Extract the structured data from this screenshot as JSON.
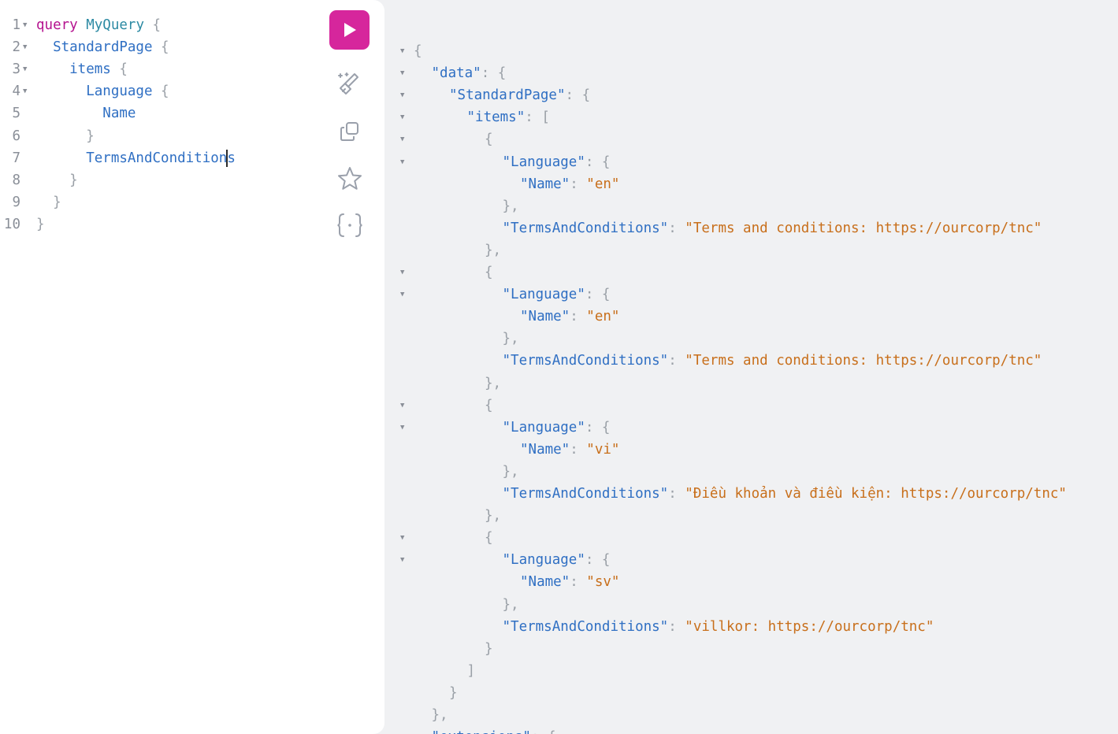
{
  "editor": {
    "lines": [
      {
        "num": "1",
        "tokens": [
          {
            "t": "query",
            "c": "kw"
          },
          {
            "t": " ",
            "c": ""
          },
          {
            "t": "MyQuery",
            "c": "op"
          },
          {
            "t": " {",
            "c": "pn"
          }
        ]
      },
      {
        "num": "2",
        "tokens": [
          {
            "t": "  StandardPage",
            "c": "fld"
          },
          {
            "t": " {",
            "c": "pn"
          }
        ]
      },
      {
        "num": "3",
        "tokens": [
          {
            "t": "    items",
            "c": "fld"
          },
          {
            "t": " {",
            "c": "pn"
          }
        ]
      },
      {
        "num": "4",
        "tokens": [
          {
            "t": "      Language",
            "c": "fld"
          },
          {
            "t": " {",
            "c": "pn"
          }
        ]
      },
      {
        "num": "5",
        "tokens": [
          {
            "t": "        Name",
            "c": "fld"
          }
        ]
      },
      {
        "num": "6",
        "tokens": [
          {
            "t": "      }",
            "c": "pn"
          }
        ]
      },
      {
        "num": "7",
        "tokens": [
          {
            "t": "      TermsAndCondition",
            "c": "fld"
          },
          {
            "t": "CURSOR",
            "c": ""
          },
          {
            "t": "s",
            "c": "fld"
          }
        ]
      },
      {
        "num": "8",
        "tokens": [
          {
            "t": "    }",
            "c": "pn"
          }
        ]
      },
      {
        "num": "9",
        "tokens": [
          {
            "t": "  }",
            "c": "pn"
          }
        ]
      },
      {
        "num": "10",
        "tokens": [
          {
            "t": "}",
            "c": "pn"
          }
        ]
      }
    ],
    "foldable_lines": [
      "1",
      "2",
      "3",
      "4"
    ]
  },
  "toolbar": {
    "run_button": {
      "label": "Execute query",
      "icon": "play-icon",
      "color": "#d6269c"
    },
    "tools": [
      {
        "name": "prettify-button",
        "icon": "prettify-icon"
      },
      {
        "name": "copy-button",
        "icon": "copy-icon"
      },
      {
        "name": "favorite-button",
        "icon": "star-icon"
      },
      {
        "name": "merge-fragments-button",
        "icon": "merge-icon"
      }
    ]
  },
  "result": {
    "lines": [
      {
        "indent": 0,
        "fold": true,
        "tokens": [
          {
            "t": "{",
            "c": "pn"
          }
        ]
      },
      {
        "indent": 1,
        "fold": true,
        "tokens": [
          {
            "t": "\"data\"",
            "c": "key"
          },
          {
            "t": ": {",
            "c": "pn"
          }
        ]
      },
      {
        "indent": 2,
        "fold": true,
        "tokens": [
          {
            "t": "\"StandardPage\"",
            "c": "key"
          },
          {
            "t": ": {",
            "c": "pn"
          }
        ]
      },
      {
        "indent": 3,
        "fold": true,
        "tokens": [
          {
            "t": "\"items\"",
            "c": "key"
          },
          {
            "t": ": [",
            "c": "pn"
          }
        ]
      },
      {
        "indent": 4,
        "fold": true,
        "tokens": [
          {
            "t": "{",
            "c": "pn"
          }
        ]
      },
      {
        "indent": 5,
        "fold": true,
        "tokens": [
          {
            "t": "\"Language\"",
            "c": "key"
          },
          {
            "t": ": {",
            "c": "pn"
          }
        ]
      },
      {
        "indent": 6,
        "fold": false,
        "tokens": [
          {
            "t": "\"Name\"",
            "c": "key"
          },
          {
            "t": ": ",
            "c": "pn"
          },
          {
            "t": "\"en\"",
            "c": "str"
          }
        ]
      },
      {
        "indent": 5,
        "fold": false,
        "tokens": [
          {
            "t": "},",
            "c": "pn"
          }
        ]
      },
      {
        "indent": 5,
        "fold": false,
        "tokens": [
          {
            "t": "\"TermsAndConditions\"",
            "c": "key"
          },
          {
            "t": ": ",
            "c": "pn"
          },
          {
            "t": "\"Terms and conditions: https://ourcorp/tnc\"",
            "c": "str"
          }
        ]
      },
      {
        "indent": 4,
        "fold": false,
        "tokens": [
          {
            "t": "},",
            "c": "pn"
          }
        ]
      },
      {
        "indent": 4,
        "fold": true,
        "tokens": [
          {
            "t": "{",
            "c": "pn"
          }
        ]
      },
      {
        "indent": 5,
        "fold": true,
        "tokens": [
          {
            "t": "\"Language\"",
            "c": "key"
          },
          {
            "t": ": {",
            "c": "pn"
          }
        ]
      },
      {
        "indent": 6,
        "fold": false,
        "tokens": [
          {
            "t": "\"Name\"",
            "c": "key"
          },
          {
            "t": ": ",
            "c": "pn"
          },
          {
            "t": "\"en\"",
            "c": "str"
          }
        ]
      },
      {
        "indent": 5,
        "fold": false,
        "tokens": [
          {
            "t": "},",
            "c": "pn"
          }
        ]
      },
      {
        "indent": 5,
        "fold": false,
        "tokens": [
          {
            "t": "\"TermsAndConditions\"",
            "c": "key"
          },
          {
            "t": ": ",
            "c": "pn"
          },
          {
            "t": "\"Terms and conditions: https://ourcorp/tnc\"",
            "c": "str"
          }
        ]
      },
      {
        "indent": 4,
        "fold": false,
        "tokens": [
          {
            "t": "},",
            "c": "pn"
          }
        ]
      },
      {
        "indent": 4,
        "fold": true,
        "tokens": [
          {
            "t": "{",
            "c": "pn"
          }
        ]
      },
      {
        "indent": 5,
        "fold": true,
        "tokens": [
          {
            "t": "\"Language\"",
            "c": "key"
          },
          {
            "t": ": {",
            "c": "pn"
          }
        ]
      },
      {
        "indent": 6,
        "fold": false,
        "tokens": [
          {
            "t": "\"Name\"",
            "c": "key"
          },
          {
            "t": ": ",
            "c": "pn"
          },
          {
            "t": "\"vi\"",
            "c": "str"
          }
        ]
      },
      {
        "indent": 5,
        "fold": false,
        "tokens": [
          {
            "t": "},",
            "c": "pn"
          }
        ]
      },
      {
        "indent": 5,
        "fold": false,
        "tokens": [
          {
            "t": "\"TermsAndConditions\"",
            "c": "key"
          },
          {
            "t": ": ",
            "c": "pn"
          },
          {
            "t": "\"Điều khoản và điều kiện: https://ourcorp/tnc\"",
            "c": "str"
          }
        ]
      },
      {
        "indent": 4,
        "fold": false,
        "tokens": [
          {
            "t": "},",
            "c": "pn"
          }
        ]
      },
      {
        "indent": 4,
        "fold": true,
        "tokens": [
          {
            "t": "{",
            "c": "pn"
          }
        ]
      },
      {
        "indent": 5,
        "fold": true,
        "tokens": [
          {
            "t": "\"Language\"",
            "c": "key"
          },
          {
            "t": ": {",
            "c": "pn"
          }
        ]
      },
      {
        "indent": 6,
        "fold": false,
        "tokens": [
          {
            "t": "\"Name\"",
            "c": "key"
          },
          {
            "t": ": ",
            "c": "pn"
          },
          {
            "t": "\"sv\"",
            "c": "str"
          }
        ]
      },
      {
        "indent": 5,
        "fold": false,
        "tokens": [
          {
            "t": "},",
            "c": "pn"
          }
        ]
      },
      {
        "indent": 5,
        "fold": false,
        "tokens": [
          {
            "t": "\"TermsAndConditions\"",
            "c": "key"
          },
          {
            "t": ": ",
            "c": "pn"
          },
          {
            "t": "\"villkor: https://ourcorp/tnc\"",
            "c": "str"
          }
        ]
      },
      {
        "indent": 4,
        "fold": false,
        "tokens": [
          {
            "t": "}",
            "c": "pn"
          }
        ]
      },
      {
        "indent": 3,
        "fold": false,
        "tokens": [
          {
            "t": "]",
            "c": "pn"
          }
        ]
      },
      {
        "indent": 2,
        "fold": false,
        "tokens": [
          {
            "t": "}",
            "c": "pn"
          }
        ]
      },
      {
        "indent": 1,
        "fold": false,
        "tokens": [
          {
            "t": "},",
            "c": "pn"
          }
        ]
      },
      {
        "indent": 1,
        "fold": true,
        "tokens": [
          {
            "t": "\"extensions\"",
            "c": "key"
          },
          {
            "t": ": {",
            "c": "pn"
          }
        ]
      }
    ]
  }
}
